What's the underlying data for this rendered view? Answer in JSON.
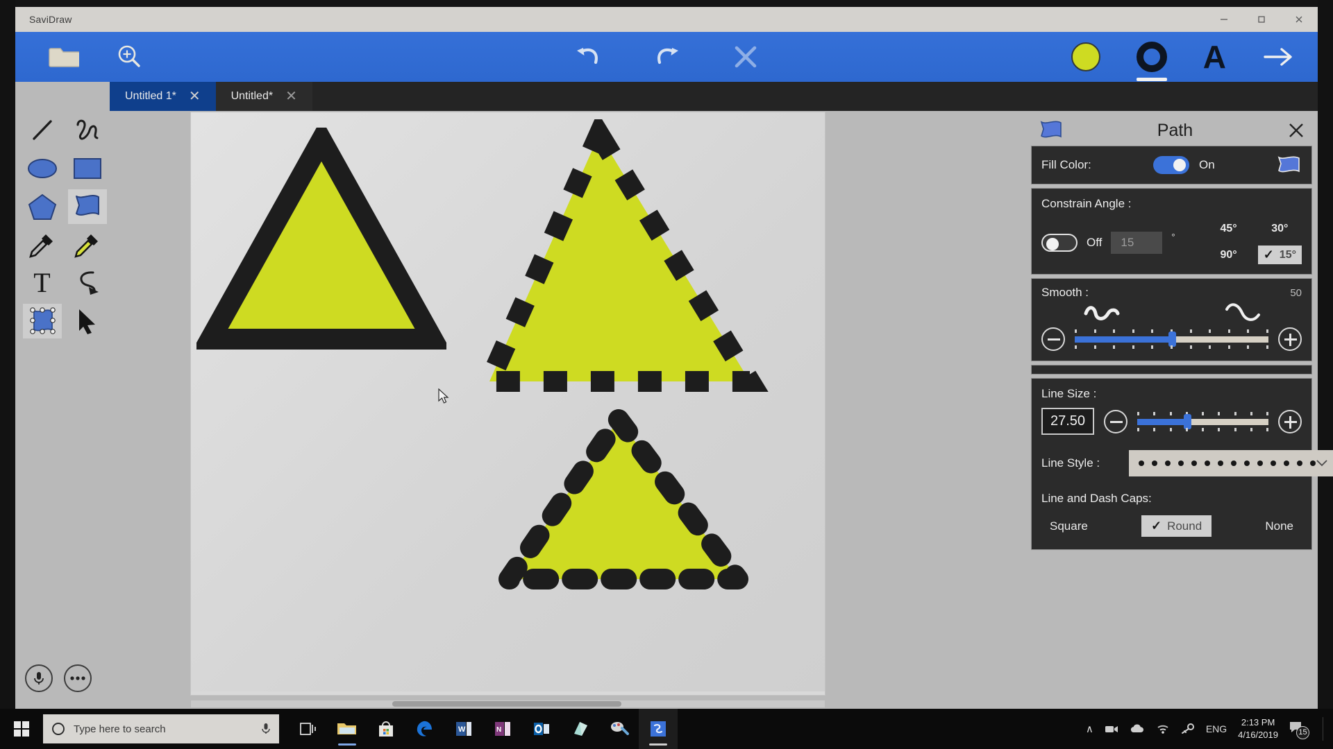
{
  "window": {
    "app_title": "SaviDraw",
    "minimize_label": "minimize",
    "maximize_label": "maximize",
    "close_label": "close"
  },
  "toolbar": {
    "open_label": "open-file",
    "zoom_label": "zoom-in",
    "undo_label": "undo",
    "redo_label": "redo",
    "clear_label": "close-shape",
    "fill_color_swatch": "#cedb22",
    "stroke_color_swatch": "#0d1522",
    "text_color_label": "A",
    "next_label": "next"
  },
  "tabs": [
    {
      "label": "Untitled 1*",
      "active": true,
      "close": "✕"
    },
    {
      "label": "Untitled*",
      "active": false,
      "close": "✕"
    }
  ],
  "palette": {
    "items": [
      {
        "name": "line-tool",
        "selected": false
      },
      {
        "name": "scribble-tool",
        "selected": false
      },
      {
        "name": "ellipse-tool",
        "selected": false
      },
      {
        "name": "rectangle-tool",
        "selected": false
      },
      {
        "name": "polygon-tool",
        "selected": false
      },
      {
        "name": "path-tool",
        "selected": true
      },
      {
        "name": "eyedropper-stroke-tool",
        "selected": false
      },
      {
        "name": "eyedropper-fill-tool",
        "selected": false
      },
      {
        "name": "text-tool",
        "selected": false
      },
      {
        "name": "curve-edit-tool",
        "selected": false
      },
      {
        "name": "node-edit-tool",
        "selected": false
      },
      {
        "name": "select-tool",
        "selected": false
      }
    ]
  },
  "panel": {
    "title": "Path",
    "close_label": "✕",
    "fill_color": {
      "label": "Fill Color:",
      "state_label": "On",
      "toggle_on": true
    },
    "constrain_angle": {
      "label": "Constrain Angle :",
      "state_label": "Off",
      "toggle_on": false,
      "value": "15",
      "unit": "°",
      "options": [
        {
          "label": "45°",
          "selected": false
        },
        {
          "label": "30°",
          "selected": false
        },
        {
          "label": "90°",
          "selected": false
        },
        {
          "label": "15°",
          "selected": true
        }
      ],
      "check_glyph": "✓"
    },
    "smooth": {
      "label": "Smooth :",
      "value": "50",
      "minus_label": "decrease-smooth",
      "plus_label": "increase-smooth",
      "percent": 50
    },
    "line_size": {
      "label": "Line Size :",
      "value": "27.50",
      "minus_label": "decrease-line-size",
      "plus_label": "increase-line-size",
      "percent": 38
    },
    "line_style": {
      "label": "Line Style :",
      "selected": "dotted"
    },
    "caps": {
      "label": "Line and Dash Caps:",
      "check_glyph": "✓",
      "options": [
        {
          "label": "Square",
          "selected": false
        },
        {
          "label": "Round",
          "selected": true
        },
        {
          "label": "None",
          "selected": false
        }
      ]
    }
  },
  "canvas": {
    "fill_color": "#cedb22",
    "stroke_color": "#1d1d1d",
    "shapes": [
      {
        "name": "solid-triangle",
        "style": "solid"
      },
      {
        "name": "dashed-square-cap-triangle",
        "style": "dashed-square"
      },
      {
        "name": "dotted-round-cap-triangle",
        "style": "dotted-round"
      }
    ]
  },
  "overlay": {
    "mic_label": "microphone",
    "more_label": "more-options"
  },
  "taskbar": {
    "start_label": "start",
    "search_placeholder": "Type here to search",
    "cortana_label": "cortana",
    "mic_label": "taskbar-microphone",
    "apps": [
      {
        "name": "task-view",
        "running": false
      },
      {
        "name": "file-explorer",
        "running": true
      },
      {
        "name": "microsoft-store",
        "running": false
      },
      {
        "name": "microsoft-edge",
        "running": false
      },
      {
        "name": "microsoft-word",
        "running": true
      },
      {
        "name": "microsoft-onenote",
        "running": false
      },
      {
        "name": "microsoft-outlook",
        "running": false
      },
      {
        "name": "sticky-notes",
        "running": false
      },
      {
        "name": "paint-3d",
        "running": false
      },
      {
        "name": "savidraw",
        "running": true,
        "active": true
      }
    ],
    "tray": {
      "chevron": "∧",
      "language": "ENG",
      "time": "2:13 PM",
      "date": "4/16/2019",
      "notification_count": "15"
    }
  }
}
